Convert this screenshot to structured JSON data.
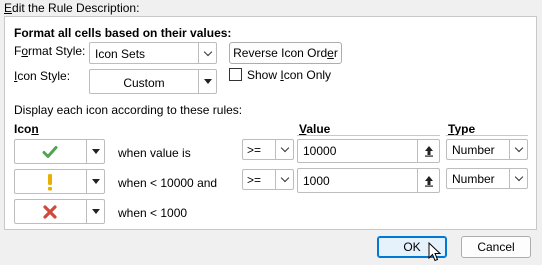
{
  "section": {
    "title_prefix": "",
    "title_key": "E",
    "title_rest": "dit the Rule Description:"
  },
  "format_all_label": "Format all cells based on their values:",
  "format_style": {
    "label_pre": "F",
    "label_key": "o",
    "label_post": "rmat Style:",
    "value": "Icon Sets"
  },
  "reverse_button": {
    "pre": "Reverse Icon Ord",
    "key": "e",
    "post": "r"
  },
  "icon_style": {
    "label_pre": "",
    "label_key": "I",
    "label_post": "con Style:",
    "value": "Custom"
  },
  "show_icon_only": {
    "pre": "Show ",
    "key": "I",
    "post": "con Only",
    "checked": false
  },
  "display_rules_label": "Display each icon according to these rules:",
  "columns": {
    "icon": {
      "pre": "Ico",
      "key": "n",
      "post": ""
    },
    "value": {
      "pre": "",
      "key": "V",
      "post": "alue"
    },
    "type": {
      "pre": "",
      "key": "T",
      "post": "ype"
    }
  },
  "rules": [
    {
      "icon": "check-icon",
      "icon_color": "#52A354",
      "condition": "when value is",
      "operator": ">=",
      "value": "10000",
      "type": "Number"
    },
    {
      "icon": "exclamation-icon",
      "icon_color": "#E8B000",
      "condition": "when < 10000 and",
      "operator": ">=",
      "value": "1000",
      "type": "Number"
    },
    {
      "icon": "cross-icon",
      "icon_color": "#D04A3A",
      "condition": "when < 1000"
    }
  ],
  "ok_button": "OK",
  "cancel_button": "Cancel",
  "colors": {
    "accent": "#0078d4",
    "ok_bg": "#e5f1fb"
  }
}
